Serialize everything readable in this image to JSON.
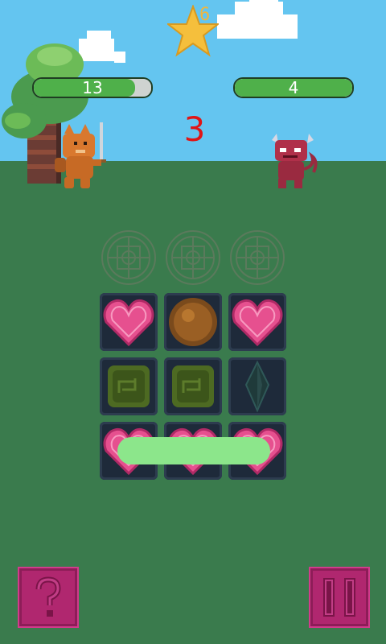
{
  "score": {
    "stars": "6"
  },
  "player": {
    "hp": "13",
    "hp_fraction": 0.86
  },
  "enemy": {
    "hp": "4",
    "hp_fraction": 1.0
  },
  "countdown": "3",
  "target_row": [
    "rune",
    "rune",
    "rune"
  ],
  "grid": [
    [
      "heart",
      "orb",
      "heart"
    ],
    [
      "leaf",
      "leaf",
      "crystal"
    ],
    [
      "heart",
      "heart",
      "heart"
    ]
  ],
  "buttons": {
    "help": "help-icon",
    "pause": "pause-icon"
  },
  "colors": {
    "accent": "#b0276f",
    "hp": "#4fb04a",
    "countdown": "#e01515"
  }
}
